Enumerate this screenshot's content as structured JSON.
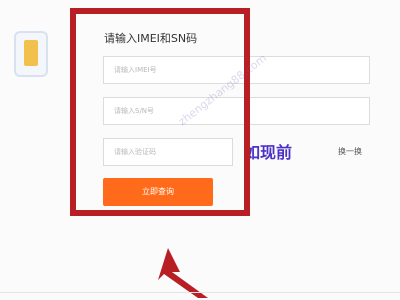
{
  "form": {
    "title": "请输入IMEI和SN码",
    "imei_placeholder": "请输入IMEI号",
    "sn_placeholder": "请输入S/N号",
    "code_placeholder": "请输入验证码",
    "captcha_text": "如现前",
    "refresh_label": "换一换",
    "submit_label": "立即查询"
  },
  "colors": {
    "highlight": "#b71f25",
    "button": "#ff6b1a",
    "captcha": "#4d31c7"
  },
  "icons": [
    "phone-icon",
    "arrow-up-icon"
  ]
}
